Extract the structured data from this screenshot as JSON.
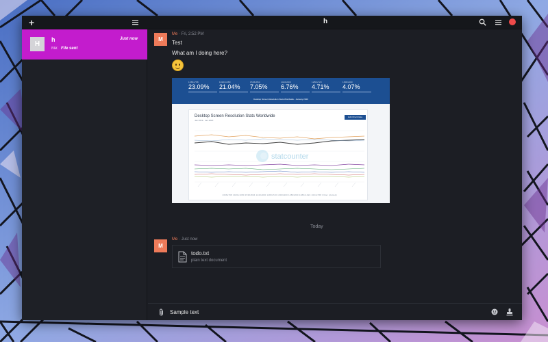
{
  "window": {
    "title": "h"
  },
  "sidebar": {
    "conversations": [
      {
        "avatar": "H",
        "name": "h",
        "time": "Just now",
        "sender": "Me:",
        "preview": "File sent"
      }
    ]
  },
  "messages": [
    {
      "avatar": "M",
      "sender": "Me",
      "time": "Fri, 2:52 PM",
      "lines": [
        "Test",
        "What am I doing here?"
      ],
      "emoji": "grinning-face-icon"
    },
    {
      "avatar": "M",
      "sender": "Me",
      "time": "Just now",
      "file": {
        "name": "todo.txt",
        "type": "plain text document"
      }
    }
  ],
  "attachment": {
    "stats": [
      {
        "label": "1366x768",
        "value": "23.09%"
      },
      {
        "label": "1920x1080",
        "value": "21.04%"
      },
      {
        "label": "1536x864",
        "value": "7.05%"
      },
      {
        "label": "1440x900",
        "value": "6.76%"
      },
      {
        "label": "1280x720",
        "value": "4.71%"
      },
      {
        "label": "1600x900",
        "value": "4.07%"
      }
    ],
    "subtitle": "Desktop Screen Resolution Stats Worldwide - January 2020",
    "card_title": "Desktop Screen Resolution Stats Worldwide",
    "card_subtitle": "Jan 2019 - Jan 2020",
    "button": "Edit Chart Data",
    "watermark": "statcounter",
    "legend": "1366x768  1920x1080  1536x864  1440x900  1280x720  1600x900  1280x800  1280x1024  1024x768  Other (dotted)"
  },
  "day_separator": "Today",
  "composer": {
    "value": "Sample text"
  },
  "colors": {
    "accent": "#c31ccd",
    "avatar": "#ee7b5a",
    "close": "#ee4a4a"
  }
}
